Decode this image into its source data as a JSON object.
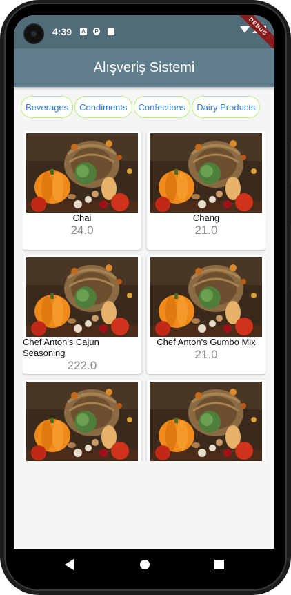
{
  "status_bar": {
    "time": "4:39",
    "debug_label": "DEBUG"
  },
  "app_bar": {
    "title": "Alışveriş Sistemi"
  },
  "categories": [
    "Beverages",
    "Condiments",
    "Confections",
    "Dairy Products"
  ],
  "products": [
    {
      "name": "Chai",
      "price": "24.0"
    },
    {
      "name": "Chang",
      "price": "21.0"
    },
    {
      "name": "Chef Anton's Cajun Seasoning",
      "price": "222.0"
    },
    {
      "name": "Chef Anton's Gumbo Mix",
      "price": "21.0"
    },
    {
      "name": "",
      "price": ""
    },
    {
      "name": "",
      "price": ""
    }
  ],
  "colors": {
    "app_bar": "#607d8b",
    "status_bar": "#526b78",
    "chip_border": "#b6f07a",
    "chip_text": "#2f7de1"
  }
}
